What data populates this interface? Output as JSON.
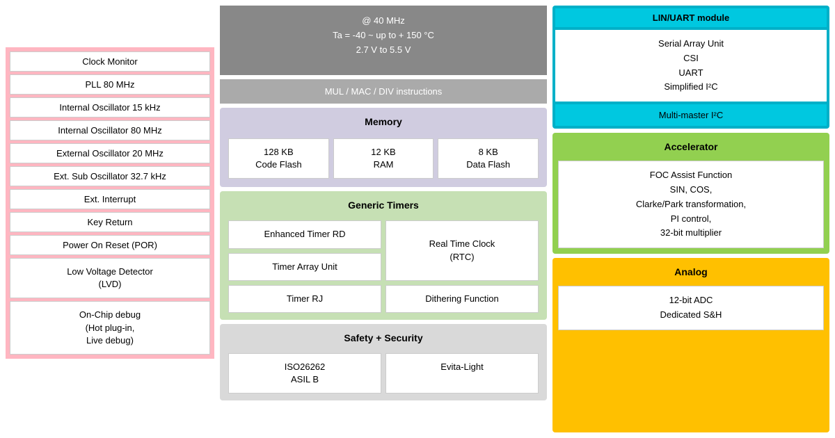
{
  "top_gray": {
    "line1": "@ 40 MHz",
    "line2": "Ta = -40 ~ up to + 150 °C",
    "line3": "2.7 V to 5.5 V"
  },
  "gray2": {
    "text": "MUL / MAC / DIV instructions"
  },
  "memory": {
    "header": "Memory",
    "cells": [
      {
        "line1": "128 KB",
        "line2": "Code Flash"
      },
      {
        "line1": "12 KB",
        "line2": "RAM"
      },
      {
        "line1": "8 KB",
        "line2": "Data Flash"
      }
    ]
  },
  "timers": {
    "header": "Generic Timers",
    "cells": [
      {
        "label": "Enhanced Timer RD"
      },
      {
        "label": "Real Time Clock\n(RTC)"
      },
      {
        "label": "Timer Array Unit"
      },
      {
        "label": "Timer RJ"
      },
      {
        "label": "Dithering Function"
      }
    ]
  },
  "safety": {
    "header": "Safety + Security",
    "cells": [
      {
        "line1": "ISO26262",
        "line2": "ASIL B"
      },
      {
        "label": "Evita-Light"
      }
    ]
  },
  "left": {
    "items": [
      "Clock Monitor",
      "PLL 80 MHz",
      "Internal Oscillator 15 kHz",
      "Internal Oscillator 80 MHz",
      "External Oscillator 20 MHz",
      "Ext. Sub Oscillator 32.7 kHz",
      "Ext. Interrupt",
      "Key Return",
      "Power On Reset (POR)"
    ],
    "tall_items": [
      {
        "text": "Low Voltage Detector\n(LVD)"
      },
      {
        "text": "On-Chip debug\n(Hot plug-in,\nLive debug)"
      }
    ]
  },
  "comm": {
    "top": "LIN/UART module",
    "mid": {
      "line1": "Serial Array Unit",
      "line2": "CSI",
      "line3": "UART",
      "line4": "Simplified I²C"
    },
    "bot": "Multi-master I²C"
  },
  "accel": {
    "header": "Accelerator",
    "content": {
      "line1": "FOC Assist Function",
      "line2": "SIN, COS,",
      "line3": "Clarke/Park transformation,",
      "line4": "PI control,",
      "line5": "32-bit multiplier"
    }
  },
  "analog": {
    "header": "Analog",
    "content": {
      "line1": "12-bit ADC",
      "line2": "Dedicated S&H"
    }
  }
}
